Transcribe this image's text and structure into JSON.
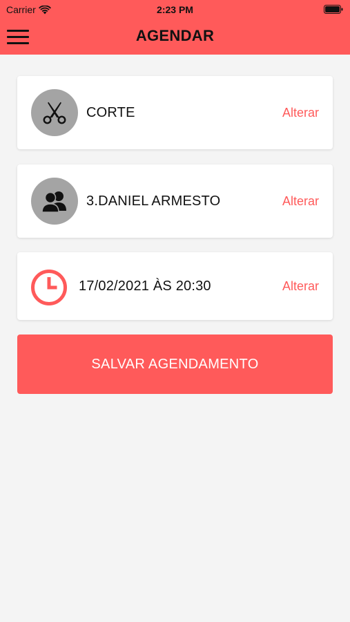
{
  "status_bar": {
    "carrier": "Carrier",
    "time": "2:23 PM"
  },
  "header": {
    "title": "AGENDAR",
    "background": "#ff5a5a"
  },
  "cards": {
    "service": {
      "label": "CORTE",
      "action": "Alterar",
      "icon": "scissors-icon"
    },
    "professional": {
      "label": "3.DANIEL ARMESTO",
      "action": "Alterar",
      "icon": "users-icon"
    },
    "datetime": {
      "label": "17/02/2021 ÀS 20:30",
      "action": "Alterar",
      "icon": "clock-icon"
    }
  },
  "save_button": {
    "label": "SALVAR AGENDAMENTO"
  },
  "colors": {
    "accent": "#ff5a5a",
    "icon_bg": "#a4a4a4",
    "background": "#f4f4f4"
  }
}
